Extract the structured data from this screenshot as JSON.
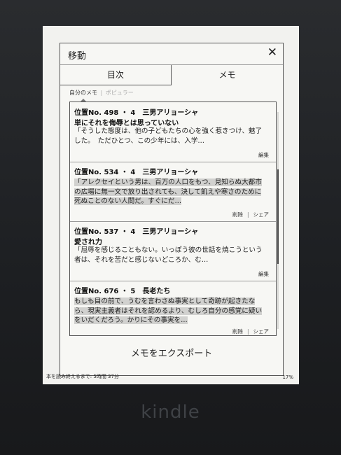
{
  "dialog": {
    "title": "移動",
    "close": "✕",
    "tabs": [
      {
        "label": "目次"
      },
      {
        "label": "メモ"
      }
    ],
    "filter_mine": "自分のメモ",
    "filter_separator": "|",
    "filter_popular": "ポピュラー"
  },
  "notes": [
    {
      "location": "位置No. 498 ・ 4　三男アリョーシャ",
      "heading": "単にそれを侮辱とは思っていない",
      "text": "「そうした態度は、他の子どもたちの心を強く惹きつけ、魅了した。　ただひとつ、この少年には、入学…",
      "actions": [
        "編集"
      ]
    },
    {
      "location": "位置No. 534 ・ 4　三男アリョーシャ",
      "heading": "",
      "text": "「アレクセイという男は、百万の人口をもつ、見知らぬ大都市の広場に無一文で放り出されても、決して飢えや寒さのために死ぬことのない人間だ。すぐにだ…",
      "actions": [
        "削除",
        "シェア"
      ]
    },
    {
      "location": "位置No. 537 ・ 4　三男アリョーシャ",
      "heading": "愛され力",
      "text": "「屈辱を感じることもない。いっぽう彼の世話を焼こうという者は、それを苦だと感じないどころか、む…",
      "actions": [
        "編集"
      ]
    },
    {
      "location": "位置No. 676 ・ 5　長老たち",
      "heading": "",
      "text": "もしも目の前で、うむを言わさぬ事実として奇跡が起きたなら、現実主義者はそれを認めるより、むしろ自分の感覚に疑いをいだくだろう。かりにその事実を…",
      "actions": [
        "削除",
        "シェア"
      ]
    }
  ],
  "export_label": "メモをエクスポート",
  "footer": {
    "reading_time": "本を読み終えるまで: 5時間 37分",
    "progress": "17%"
  },
  "device": {
    "brand": "kindle"
  }
}
